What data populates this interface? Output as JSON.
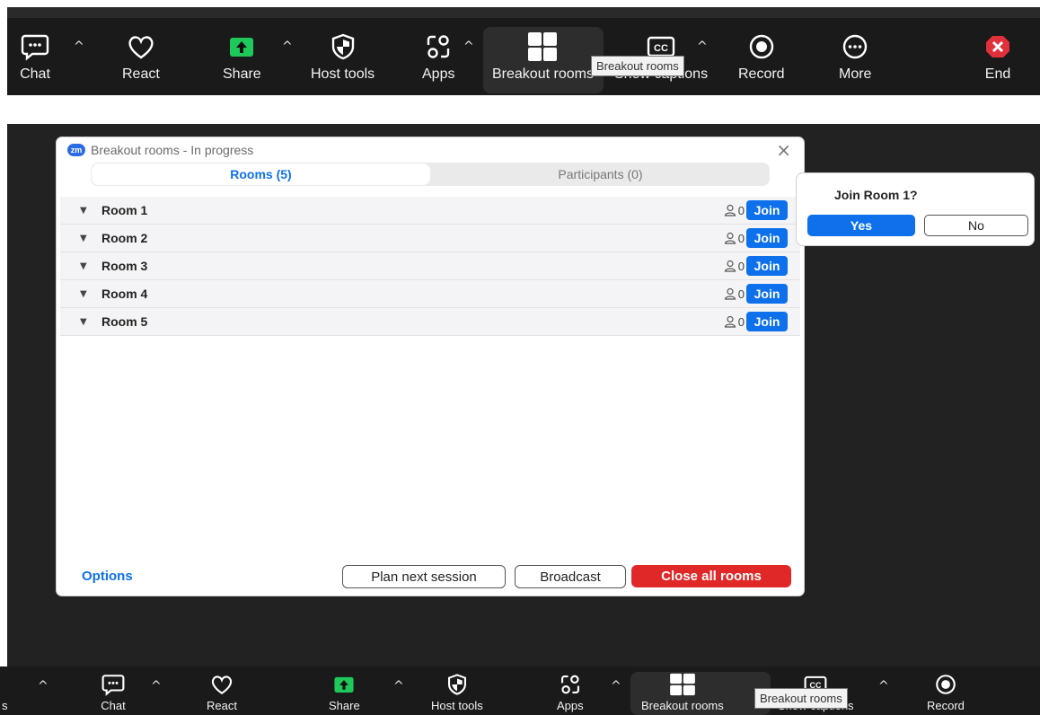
{
  "top_toolbar": {
    "items": [
      {
        "label": "Chat"
      },
      {
        "label": "React"
      },
      {
        "label": "Share"
      },
      {
        "label": "Host tools"
      },
      {
        "label": "Apps"
      },
      {
        "label": "Breakout rooms"
      },
      {
        "label": "Show captions"
      },
      {
        "label": "Record"
      },
      {
        "label": "More"
      },
      {
        "label": "End"
      }
    ],
    "tooltip": "Breakout rooms",
    "colors": {
      "share": "#1ec85a",
      "end": "#e0303a"
    }
  },
  "panel": {
    "logo": "zm",
    "title": "Breakout rooms - In progress",
    "tabs": [
      {
        "label": "Rooms (5)"
      },
      {
        "label": "Participants (0)"
      }
    ],
    "rooms": [
      {
        "name": "Room 1",
        "count": "0",
        "join": "Join"
      },
      {
        "name": "Room 2",
        "count": "0",
        "join": "Join"
      },
      {
        "name": "Room 3",
        "count": "0",
        "join": "Join"
      },
      {
        "name": "Room 4",
        "count": "0",
        "join": "Join"
      },
      {
        "name": "Room 5",
        "count": "0",
        "join": "Join"
      }
    ],
    "footer": {
      "options": "Options",
      "plan": "Plan next session",
      "broadcast": "Broadcast",
      "close_all": "Close all rooms"
    },
    "colors": {
      "accent": "#0e71eb",
      "danger": "#e02828"
    }
  },
  "popup": {
    "question": "Join Room 1?",
    "yes": "Yes",
    "no": "No"
  },
  "bottom_toolbar": {
    "left_fragment": "s",
    "items": [
      {
        "label": "Chat"
      },
      {
        "label": "React"
      },
      {
        "label": "Share"
      },
      {
        "label": "Host tools"
      },
      {
        "label": "Apps"
      },
      {
        "label": "Breakout rooms"
      },
      {
        "label": "Show captions"
      },
      {
        "label": "Record"
      }
    ],
    "tooltip": "Breakout rooms"
  }
}
